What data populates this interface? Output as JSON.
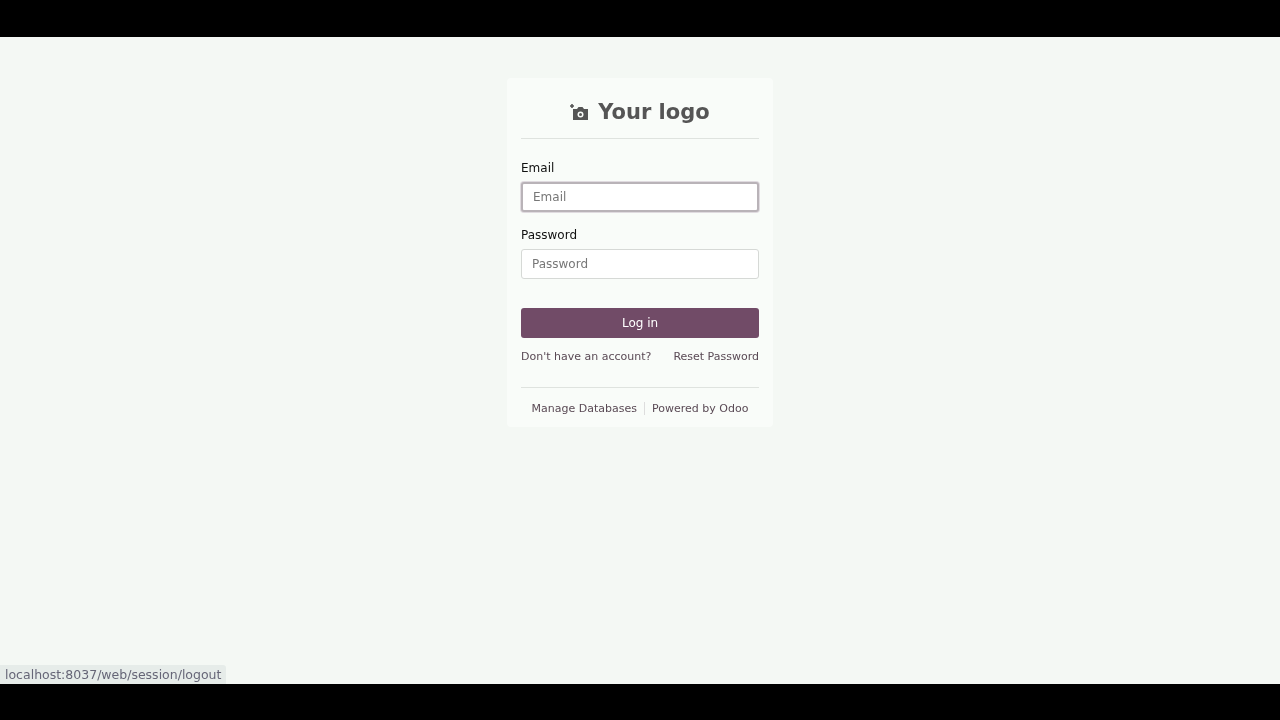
{
  "logo": {
    "text": "Your logo"
  },
  "form": {
    "fields": [
      {
        "label": "Email",
        "placeholder": "Email",
        "focused": true
      },
      {
        "label": "Password",
        "placeholder": "Password",
        "focused": false
      }
    ],
    "submit": "Log in",
    "links": [
      "Don't have an account?",
      "Reset Password"
    ]
  },
  "footer": {
    "links": [
      "Manage Databases",
      "Powered by Odoo"
    ]
  },
  "status_bar": {
    "url": "localhost:8037/web/session/logout"
  }
}
